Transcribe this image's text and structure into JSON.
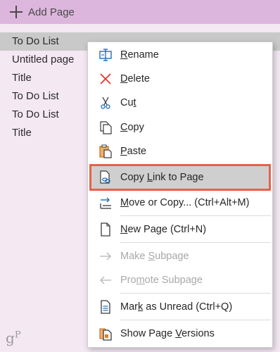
{
  "add_page": {
    "label": "Add Page"
  },
  "pages": [
    {
      "label": "To Do List",
      "selected": true
    },
    {
      "label": "Untitled page",
      "selected": false
    },
    {
      "label": "Title",
      "selected": false
    },
    {
      "label": "To Do List",
      "selected": false
    },
    {
      "label": "To Do List",
      "selected": false
    },
    {
      "label": "Title",
      "selected": false
    }
  ],
  "logo": {
    "text": "gP"
  },
  "context_menu": {
    "rename": {
      "pre": "",
      "u": "R",
      "post": "ename",
      "icon": "rename-icon"
    },
    "delete": {
      "pre": "",
      "u": "D",
      "post": "elete",
      "icon": "delete-icon"
    },
    "cut": {
      "pre": "Cu",
      "u": "t",
      "post": "",
      "icon": "scissors-icon"
    },
    "copy": {
      "pre": "",
      "u": "C",
      "post": "opy",
      "icon": "copy-icon"
    },
    "paste": {
      "pre": "",
      "u": "P",
      "post": "aste",
      "icon": "paste-icon"
    },
    "copy_link": {
      "pre": "Copy ",
      "u": "L",
      "post": "ink to Page",
      "icon": "link-page-icon"
    },
    "move_copy": {
      "pre": "",
      "u": "M",
      "post": "ove or Copy...  (Ctrl+Alt+M)",
      "icon": "move-icon"
    },
    "new_page": {
      "pre": "",
      "u": "N",
      "post": "ew Page  (Ctrl+N)",
      "icon": "new-page-icon"
    },
    "make_subpage": {
      "pre": "Make ",
      "u": "S",
      "post": "ubpage",
      "icon": "arrow-right-icon",
      "disabled": true
    },
    "promote_subpage": {
      "pre": "Pro",
      "u": "m",
      "post": "ote Subpage",
      "icon": "arrow-left-icon",
      "disabled": true
    },
    "mark_unread": {
      "pre": "Mar",
      "u": "k",
      "post": " as Unread  (Ctrl+Q)",
      "icon": "unread-page-icon"
    },
    "versions": {
      "pre": "Show Page ",
      "u": "V",
      "post": "ersions",
      "icon": "page-versions-icon"
    }
  }
}
